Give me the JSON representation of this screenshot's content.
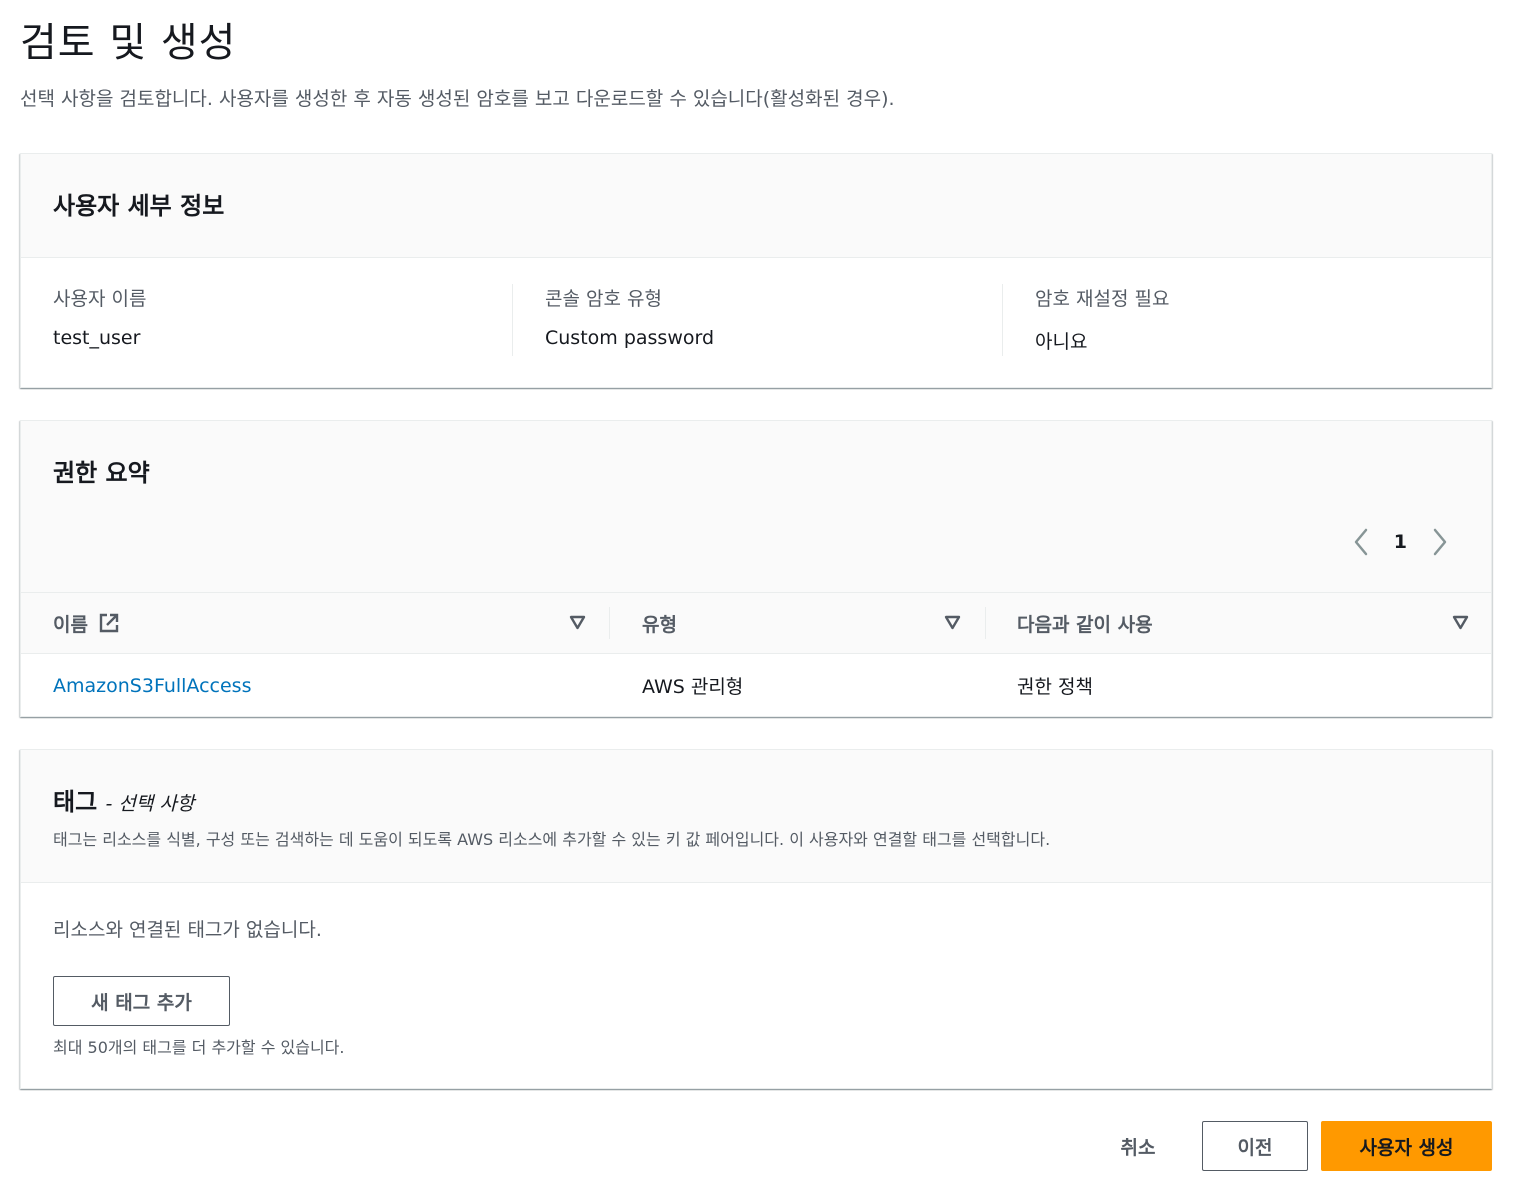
{
  "page": {
    "title": "검토 및 생성",
    "description": "선택 사항을 검토합니다. 사용자를 생성한 후 자동 생성된 암호를 보고 다운로드할 수 있습니다(활성화된 경우)."
  },
  "user_details": {
    "title": "사용자 세부 정보",
    "fields": [
      {
        "label": "사용자 이름",
        "value": "test_user"
      },
      {
        "label": "콘솔 암호 유형",
        "value": "Custom password"
      },
      {
        "label": "암호 재설정 필요",
        "value": "아니요"
      }
    ]
  },
  "permissions": {
    "title": "권한 요약",
    "pagination": {
      "current_page": "1",
      "prev_icon": "chevron-left-icon",
      "next_icon": "chevron-right-icon"
    },
    "columns": [
      "이름",
      "유형",
      "다음과 같이 사용"
    ],
    "rows": [
      {
        "name": "AmazonS3FullAccess",
        "type": "AWS 관리형",
        "used_as": "권한 정책"
      }
    ]
  },
  "tags": {
    "title": "태그",
    "title_suffix": "- 선택 사항",
    "description": "태그는 리소스를 식별, 구성 또는 검색하는 데 도움이 되도록 AWS 리소스에 추가할 수 있는 키 값 페어입니다. 이 사용자와 연결할 태그를 선택합니다.",
    "empty_text": "리소스와 연결된 태그가 없습니다.",
    "add_button": "새 태그 추가",
    "limit_text": "최대 50개의 태그를 더 추가할 수 있습니다."
  },
  "actions": {
    "cancel": "취소",
    "previous": "이전",
    "create": "사용자 생성"
  },
  "colors": {
    "primary": "#ff9900",
    "link": "#0073bb",
    "text": "#16191f",
    "secondary_text": "#545b64"
  }
}
